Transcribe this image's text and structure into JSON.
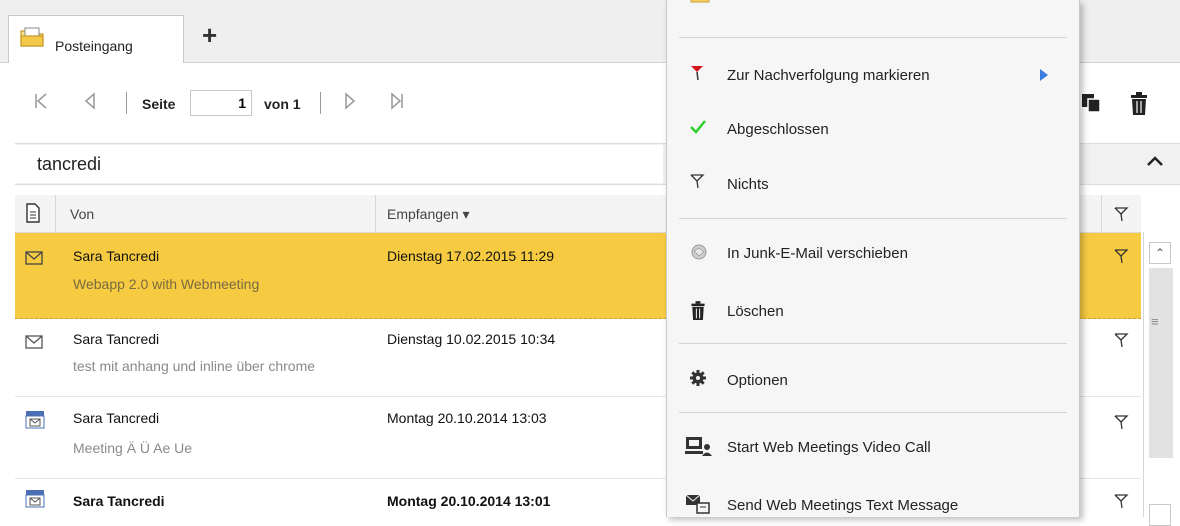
{
  "tabs": {
    "inbox_label": "Posteingang",
    "add_tab_label": "+"
  },
  "pager": {
    "page_label": "Seite",
    "page_value": "1",
    "of_label": "von 1"
  },
  "search": {
    "value": "tancredi"
  },
  "columns": {
    "from": "Von",
    "received": "Empfangen ▾"
  },
  "messages": [
    {
      "sender": "Sara Tancredi",
      "subject": "Webapp 2.0 with Webmeeting",
      "received": "Dienstag 17.02.2015 11:29",
      "icon": "mail-envelope-icon",
      "selected": true
    },
    {
      "sender": "Sara Tancredi",
      "subject": "test mit anhang und inline über chrome",
      "received": "Dienstag 10.02.2015 10:34",
      "icon": "mail-envelope-icon"
    },
    {
      "sender": "Sara Tancredi",
      "subject": "Meeting Ä Ü Ae Ue",
      "received": "Montag 20.10.2014 13:03",
      "icon": "meeting-request-icon"
    },
    {
      "sender": "Sara Tancredi",
      "subject": "",
      "received": "Montag 20.10.2014 13:01",
      "icon": "meeting-request-icon",
      "unread": true
    }
  ],
  "context_menu": {
    "items": [
      {
        "label": "Zur Nachverfolgung markieren",
        "icon": "red-flag-icon",
        "has_submenu": true
      },
      {
        "label": "Abgeschlossen",
        "icon": "check-icon"
      },
      {
        "label": "Nichts",
        "icon": "empty-flag-icon"
      },
      {
        "label": "In Junk-E-Mail verschieben",
        "icon": "junk-icon"
      },
      {
        "label": "Löschen",
        "icon": "trash-icon"
      },
      {
        "label": "Optionen",
        "icon": "gear-icon"
      },
      {
        "label": "Start Web Meetings Video Call",
        "icon": "video-call-icon"
      },
      {
        "label": "Send Web Meetings Text Message",
        "icon": "text-message-icon"
      }
    ]
  },
  "colors": {
    "selected_row": "#f6cb42",
    "flag_red": "#d4141b",
    "check_green": "#2fcf2f",
    "submenu_arrow": "#3b7ddd"
  }
}
